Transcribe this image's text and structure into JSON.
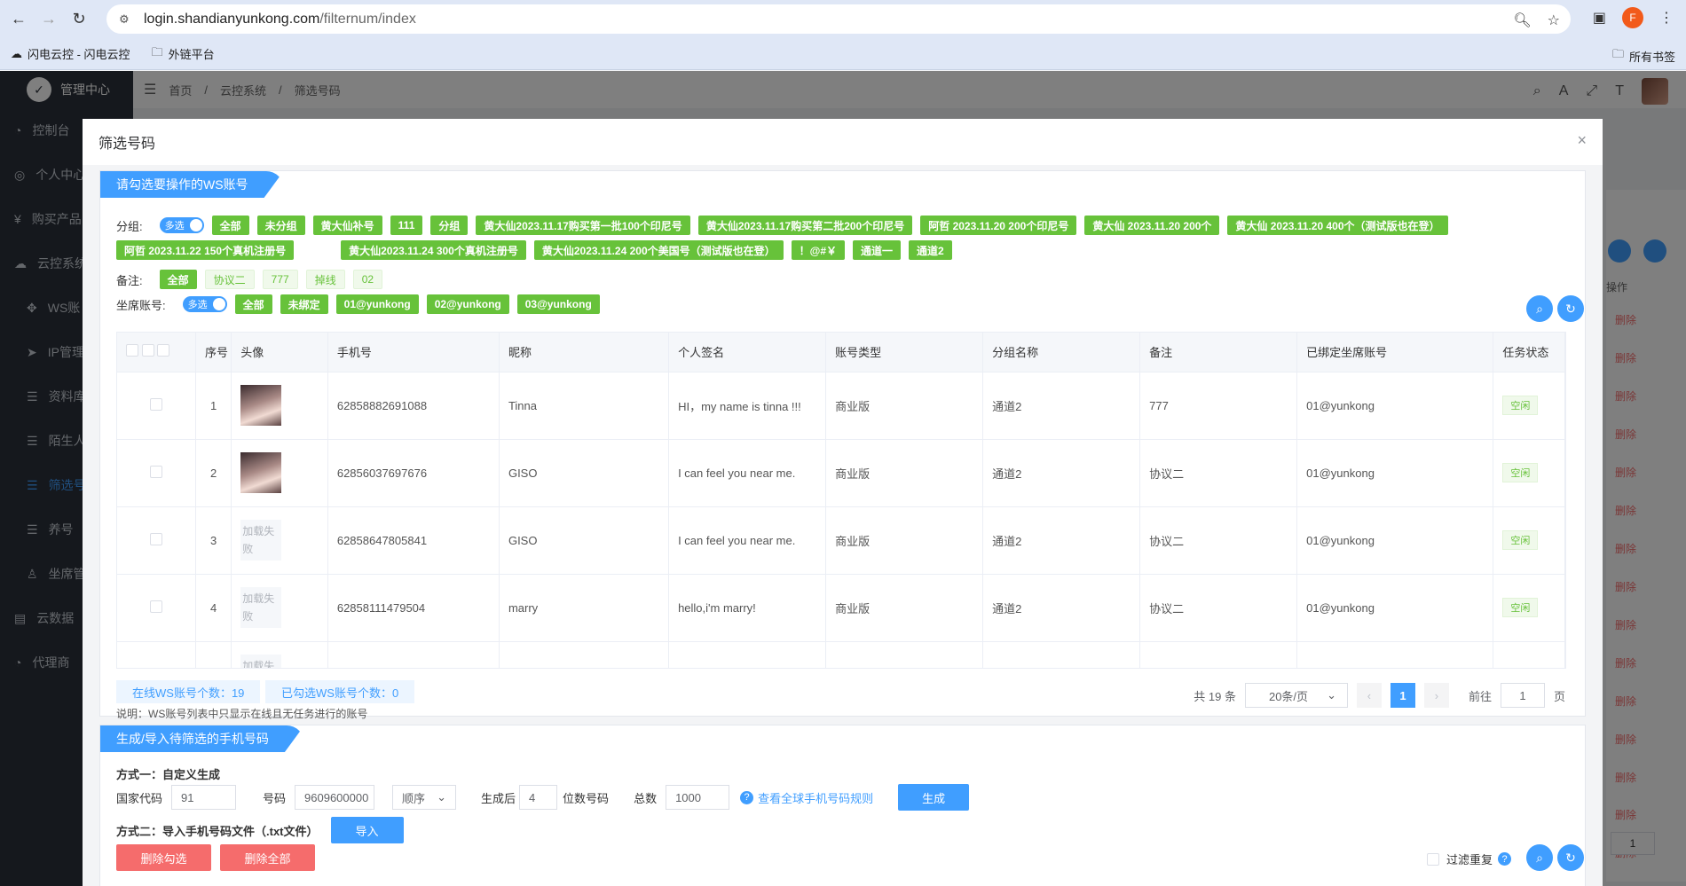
{
  "browser": {
    "url_host": "login.shandianyunkong.com",
    "url_path": "/filternum/index",
    "profile_letter": "F",
    "bookmarks": [
      "闪电云控 - 闪电云控",
      "外链平台"
    ],
    "all_bookmarks": "所有书签"
  },
  "app": {
    "brand": "管理中心",
    "menu": [
      "控制台",
      "个人中心",
      "购买产品",
      "云控系统",
      "WS账",
      "IP管理",
      "资料库",
      "陌生人",
      "筛选号",
      "养号",
      "坐席管",
      "云数据",
      "代理商"
    ],
    "breadcrumb": [
      "首页",
      "云控系统",
      "筛选号码"
    ],
    "bg_op_header": "操作",
    "bg_delete": "删除",
    "bg_page": "1"
  },
  "dialog": {
    "title": "筛选号码",
    "section1_title": "请勾选要操作的WS账号",
    "group_label": "分组:",
    "multi_label": "多选",
    "groups": [
      "全部",
      "未分组",
      "黄大仙补号",
      "111",
      "分组",
      "黄大仙2023.11.17购买第一批100个印尼号",
      "黄大仙2023.11.17购买第二批200个印尼号",
      "阿哲 2023.11.20 200个印尼号",
      "黄大仙 2023.11.20 200个",
      "黄大仙 2023.11.20 400个（测试版也在登）",
      "阿哲 2023.11.22 150个真机注册号",
      "黄大仙2023.11.24 300个真机注册号",
      "黄大仙2023.11.24 200个美国号（测试版也在登）",
      "！@#￥",
      "通道一",
      "通道2"
    ],
    "remark_label": "备注:",
    "remarks": [
      "全部",
      "协议二",
      "777",
      "掉线",
      "02"
    ],
    "seat_label": "坐席账号:",
    "seats": [
      "全部",
      "未绑定",
      "01@yunkong",
      "02@yunkong",
      "03@yunkong"
    ],
    "columns": [
      "序号",
      "头像",
      "手机号",
      "昵称",
      "个人签名",
      "账号类型",
      "分组名称",
      "备注",
      "已绑定坐席账号",
      "任务状态"
    ],
    "avatar_fail": "加载失败",
    "rows": [
      {
        "idx": "1",
        "phone": "62858882691088",
        "nick": "Tinna",
        "sign": "HI，my name is tinna !!!",
        "type": "商业版",
        "group": "通道2",
        "remark": "777",
        "seat": "01@yunkong",
        "status": "空闲"
      },
      {
        "idx": "2",
        "phone": "62856037697676",
        "nick": "GISO",
        "sign": "I can feel you near me.",
        "type": "商业版",
        "group": "通道2",
        "remark": "协议二",
        "seat": "01@yunkong",
        "status": "空闲"
      },
      {
        "idx": "3",
        "phone": "62858647805841",
        "nick": "GISO",
        "sign": "I can feel you near me.",
        "type": "商业版",
        "group": "通道2",
        "remark": "协议二",
        "seat": "01@yunkong",
        "status": "空闲"
      },
      {
        "idx": "4",
        "phone": "62858111479504",
        "nick": "marry",
        "sign": "hello,i'm marry!",
        "type": "商业版",
        "group": "通道2",
        "remark": "协议二",
        "seat": "01@yunkong",
        "status": "空闲"
      }
    ],
    "online_count": "在线WS账号个数：19",
    "selected_count": "已勾选WS账号个数：0",
    "note": "说明：WS账号列表中只显示在线且无任务进行的账号",
    "pager": {
      "total": "共 19 条",
      "size": "20条/页",
      "current": "1",
      "goto_label": "前往",
      "goto_value": "1",
      "page_unit": "页"
    },
    "section2_title": "生成/导入待筛选的手机号码",
    "method1": "方式一：自定义生成",
    "country_label": "国家代码",
    "country_value": "91",
    "number_label": "号码",
    "number_value": "9609600000",
    "order_value": "顺序",
    "after_label": "生成后",
    "after_value": "4",
    "digits_label": "位数号码",
    "total_label": "总数",
    "total_value": "1000",
    "rule_link": "查看全球手机号码规则",
    "generate_btn": "生成",
    "method2": "方式二：导入手机号码文件（.txt文件）",
    "import_btn": "导入",
    "delete_selected_btn": "删除勾选",
    "delete_all_btn": "删除全部",
    "filter_dup_label": "过滤重复"
  },
  "colors": {
    "primary": "#409eff",
    "success": "#67c23a",
    "danger": "#f56c6c"
  }
}
